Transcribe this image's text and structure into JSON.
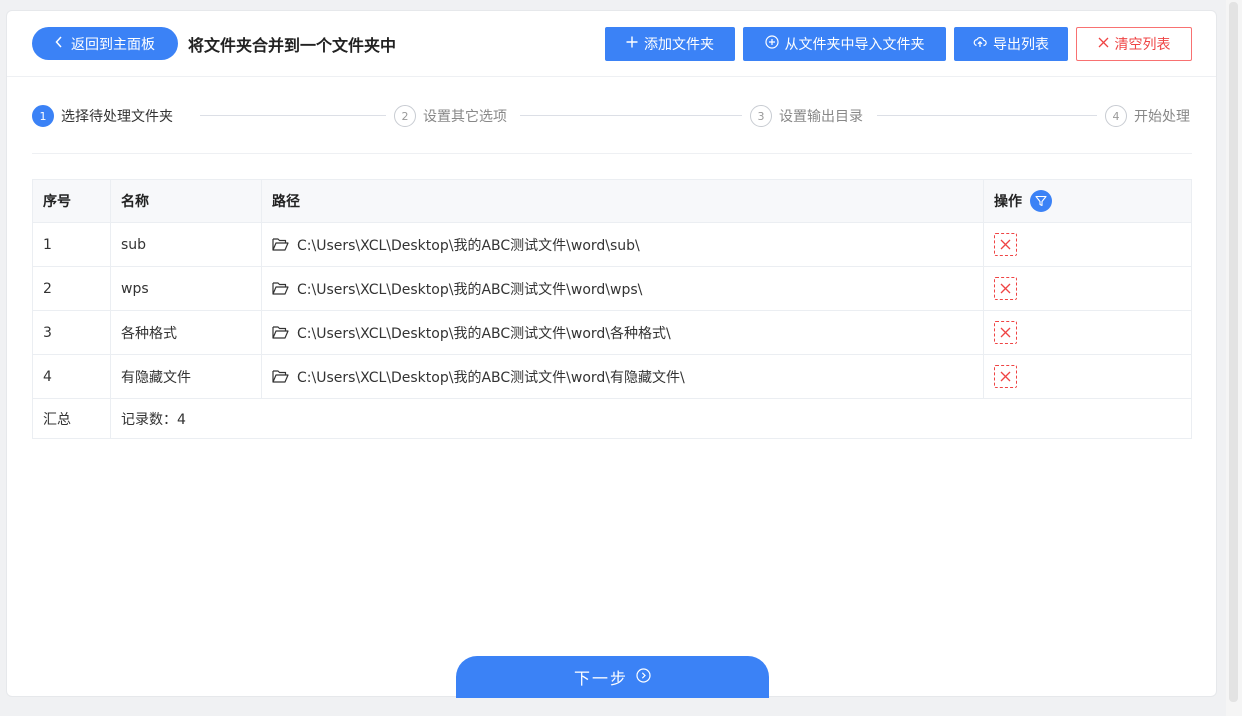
{
  "header": {
    "back_label": "返回到主面板",
    "title": "将文件夹合并到一个文件夹中",
    "add_folder": "添加文件夹",
    "import_folder": "从文件夹中导入文件夹",
    "export_list": "导出列表",
    "clear_list": "清空列表"
  },
  "steps": [
    {
      "num": "1",
      "label": "选择待处理文件夹"
    },
    {
      "num": "2",
      "label": "设置其它选项"
    },
    {
      "num": "3",
      "label": "设置输出目录"
    },
    {
      "num": "4",
      "label": "开始处理"
    }
  ],
  "table": {
    "columns": {
      "index": "序号",
      "name": "名称",
      "path": "路径",
      "op": "操作"
    },
    "rows": [
      {
        "index": "1",
        "name": "sub",
        "path": "C:\\Users\\XCL\\Desktop\\我的ABC测试文件\\word\\sub\\"
      },
      {
        "index": "2",
        "name": "wps",
        "path": "C:\\Users\\XCL\\Desktop\\我的ABC测试文件\\word\\wps\\"
      },
      {
        "index": "3",
        "name": "各种格式",
        "path": "C:\\Users\\XCL\\Desktop\\我的ABC测试文件\\word\\各种格式\\"
      },
      {
        "index": "4",
        "name": "有隐藏文件",
        "path": "C:\\Users\\XCL\\Desktop\\我的ABC测试文件\\word\\有隐藏文件\\"
      }
    ],
    "summary": {
      "label": "汇总",
      "count": "记录数：4"
    }
  },
  "footer": {
    "next_label": "下一步"
  },
  "colors": {
    "accent": "#3b82f6",
    "danger": "#ef4444"
  }
}
